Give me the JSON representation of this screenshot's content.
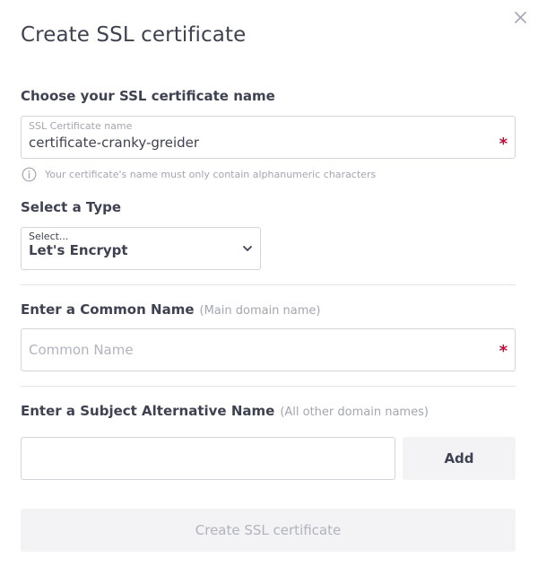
{
  "dialog": {
    "title": "Create SSL certificate",
    "close_icon": "close-icon"
  },
  "name_section": {
    "label": "Choose your SSL certificate name",
    "input_label": "SSL Certificate name",
    "input_value": "certificate-cranky-greider",
    "required_mark": "*",
    "help_icon": "info-icon",
    "help_text": "Your certificate's name must only contain alphanumeric characters"
  },
  "type_section": {
    "label": "Select a Type",
    "select_label": "Select...",
    "selected_value": "Let's Encrypt",
    "chevron_icon": "chevron-down-icon"
  },
  "common_name_section": {
    "label": "Enter a Common Name",
    "hint": "(Main domain name)",
    "placeholder": "Common Name",
    "required_mark": "*"
  },
  "san_section": {
    "label": "Enter a Subject Alternative Name",
    "hint": "(All other domain names)",
    "input_value": "",
    "add_button": "Add"
  },
  "submit_button": "Create SSL certificate",
  "colors": {
    "text": "#3f4250",
    "muted": "#a3a6b1",
    "required": "#c3093a",
    "border": "#d4d5dc",
    "button_bg": "#f3f3f5"
  }
}
